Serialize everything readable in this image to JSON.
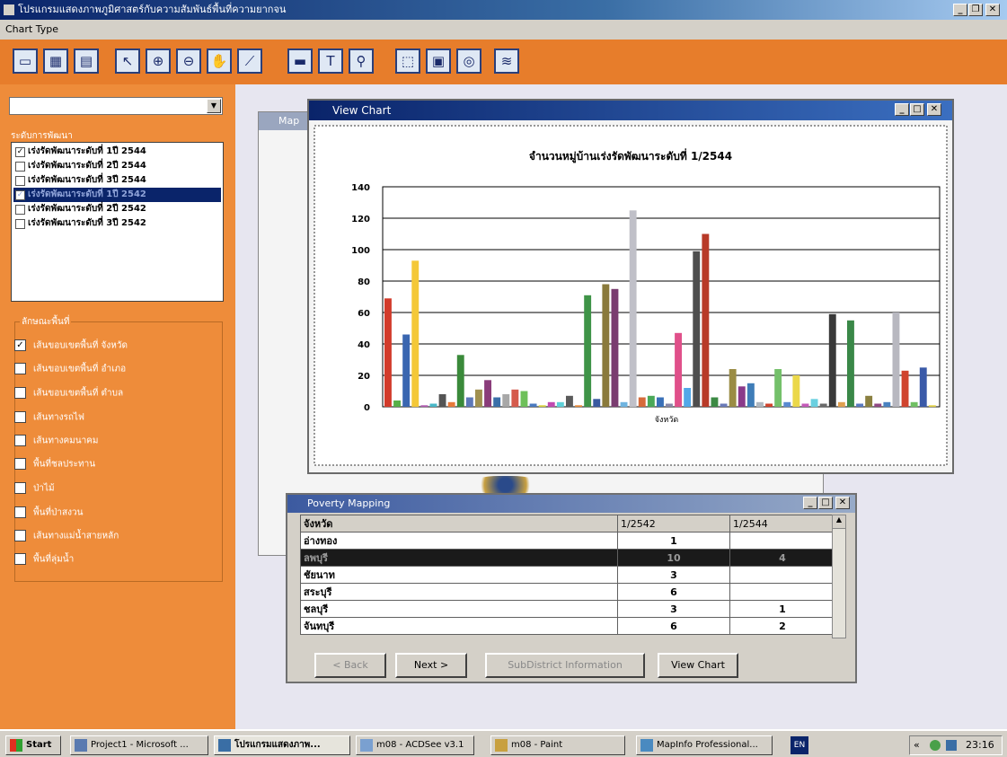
{
  "app": {
    "title": "โปรแกรมแสดงภาพภูมิศาสตร์กับความสัมพันธ์พื้นที่ความยากจน",
    "menu": [
      "Chart Type"
    ]
  },
  "left": {
    "combo_value": "",
    "dev_level_label": "ระดับการพัฒนา",
    "levels": [
      {
        "label": "เร่งรัดพัฒนาระดับที่ 1ปี 2544",
        "checked": true
      },
      {
        "label": "เร่งรัดพัฒนาระดับที่ 2ปี 2544",
        "checked": false
      },
      {
        "label": "เร่งรัดพัฒนาระดับที่ 3ปี 2544",
        "checked": false
      },
      {
        "label": "เร่งรัดพัฒนาระดับที่ 1ปี 2542",
        "checked": true
      },
      {
        "label": "เร่งรัดพัฒนาระดับที่ 2ปี 2542",
        "checked": false
      },
      {
        "label": "เร่งรัดพัฒนาระดับที่ 3ปี 2542",
        "checked": false
      }
    ],
    "area_label": "ลักษณะพื้นที่",
    "areas": [
      {
        "label": "เส้นขอบเขตพื้นที่ จังหวัด",
        "checked": true
      },
      {
        "label": "เส้นขอบเขตพื้นที่ อำเภอ",
        "checked": false
      },
      {
        "label": "เส้นขอบเขตพื้นที่ ตำบล",
        "checked": false
      },
      {
        "label": "เส้นทางรถไฟ",
        "checked": false
      },
      {
        "label": "เส้นทางคมนาคม",
        "checked": false
      },
      {
        "label": "พื้นที่ชลประทาน",
        "checked": false
      },
      {
        "label": "ป่าไม้",
        "checked": false
      },
      {
        "label": "พื้นที่ป่าสงวน",
        "checked": false
      },
      {
        "label": "เส้นทางแม่น้ำสายหลัก",
        "checked": false
      },
      {
        "label": "พื้นที่ลุ่มน้ำ",
        "checked": false
      }
    ]
  },
  "map_window": {
    "title": "Map"
  },
  "chart_window": {
    "title": "View Chart"
  },
  "chart_data": {
    "type": "bar",
    "title": "จำนวนหมู่บ้านเร่งรัดพัฒนาระดับที่ 1/2544",
    "xlabel": "จังหวัด",
    "ylabel": "",
    "ylim": [
      0,
      140
    ],
    "yticks": [
      0,
      20,
      40,
      60,
      80,
      100,
      120,
      140
    ],
    "grid": true,
    "values": [
      69,
      4,
      46,
      93,
      1,
      2,
      8,
      3,
      33,
      6,
      11,
      17,
      6,
      8,
      11,
      10,
      2,
      1,
      3,
      3,
      7,
      1,
      71,
      5,
      78,
      75,
      3,
      125,
      6,
      7,
      6,
      2,
      47,
      12,
      99,
      110,
      6,
      2,
      24,
      13,
      15,
      3,
      2,
      24,
      3,
      20,
      2,
      5,
      2,
      59,
      3,
      55,
      2,
      7,
      2,
      3,
      60,
      23,
      3,
      25,
      1
    ],
    "colors": [
      "#d23b2b",
      "#58b048",
      "#3a66b0",
      "#f4c837",
      "#b05ab0",
      "#49b8c8",
      "#545454",
      "#e7793a",
      "#3a8a3a",
      "#5d78b8",
      "#a09050",
      "#8a3c7a",
      "#3a6fa8",
      "#a8a8a8",
      "#d55a4c",
      "#6ec05a",
      "#4a7ac0",
      "#d6d040",
      "#c04ab0",
      "#5fd0d8",
      "#5a5a5a",
      "#e88a3a",
      "#3f9448",
      "#3a5aa0",
      "#8a7a3c",
      "#7a3c70",
      "#6fb4e0",
      "#c0c0c8",
      "#d66a3a",
      "#4aa858",
      "#3a70b8",
      "#8888a8",
      "#e0508a",
      "#52a8e8",
      "#4e4e4e",
      "#b83a28",
      "#3c8a44",
      "#6a7ab8",
      "#9a8c44",
      "#8a3a8a",
      "#3f7db8",
      "#b0b8c0",
      "#d0442e",
      "#74c06a",
      "#5a8ad0",
      "#ebd84a",
      "#c45ab8",
      "#6ad0e0",
      "#6a6a6a",
      "#3a3a3a",
      "#e0a050",
      "#3a8848",
      "#5a7ac0",
      "#8a8040",
      "#904884",
      "#4a82c0",
      "#b8b8c0",
      "#d0442e",
      "#70c064",
      "#3a5aa8",
      "#e0d048"
    ]
  },
  "poverty_window": {
    "title": "Poverty Mapping",
    "columns": [
      "จังหวัด",
      "1/2542",
      "1/2544"
    ],
    "rows": [
      [
        "อ่างทอง",
        "1",
        ""
      ],
      [
        "ลพบุรี",
        "10",
        "4"
      ],
      [
        "ชัยนาท",
        "3",
        ""
      ],
      [
        "สระบุรี",
        "6",
        ""
      ],
      [
        "ชลบุรี",
        "3",
        "1"
      ],
      [
        "จันทบุรี",
        "6",
        "2"
      ]
    ],
    "buttons": {
      "back": "< Back",
      "next": "Next >",
      "subdistrict": "SubDistrict Information",
      "view_chart": "View Chart"
    }
  },
  "taskbar": {
    "start": "Start",
    "items": [
      "Project1 - Microsoft ...",
      "โปรแกรมแสดงภาพ...",
      "m08 - ACDSee v3.1",
      "m08 - Paint",
      "MapInfo Professional..."
    ],
    "lang": "EN",
    "time": "23:16"
  }
}
